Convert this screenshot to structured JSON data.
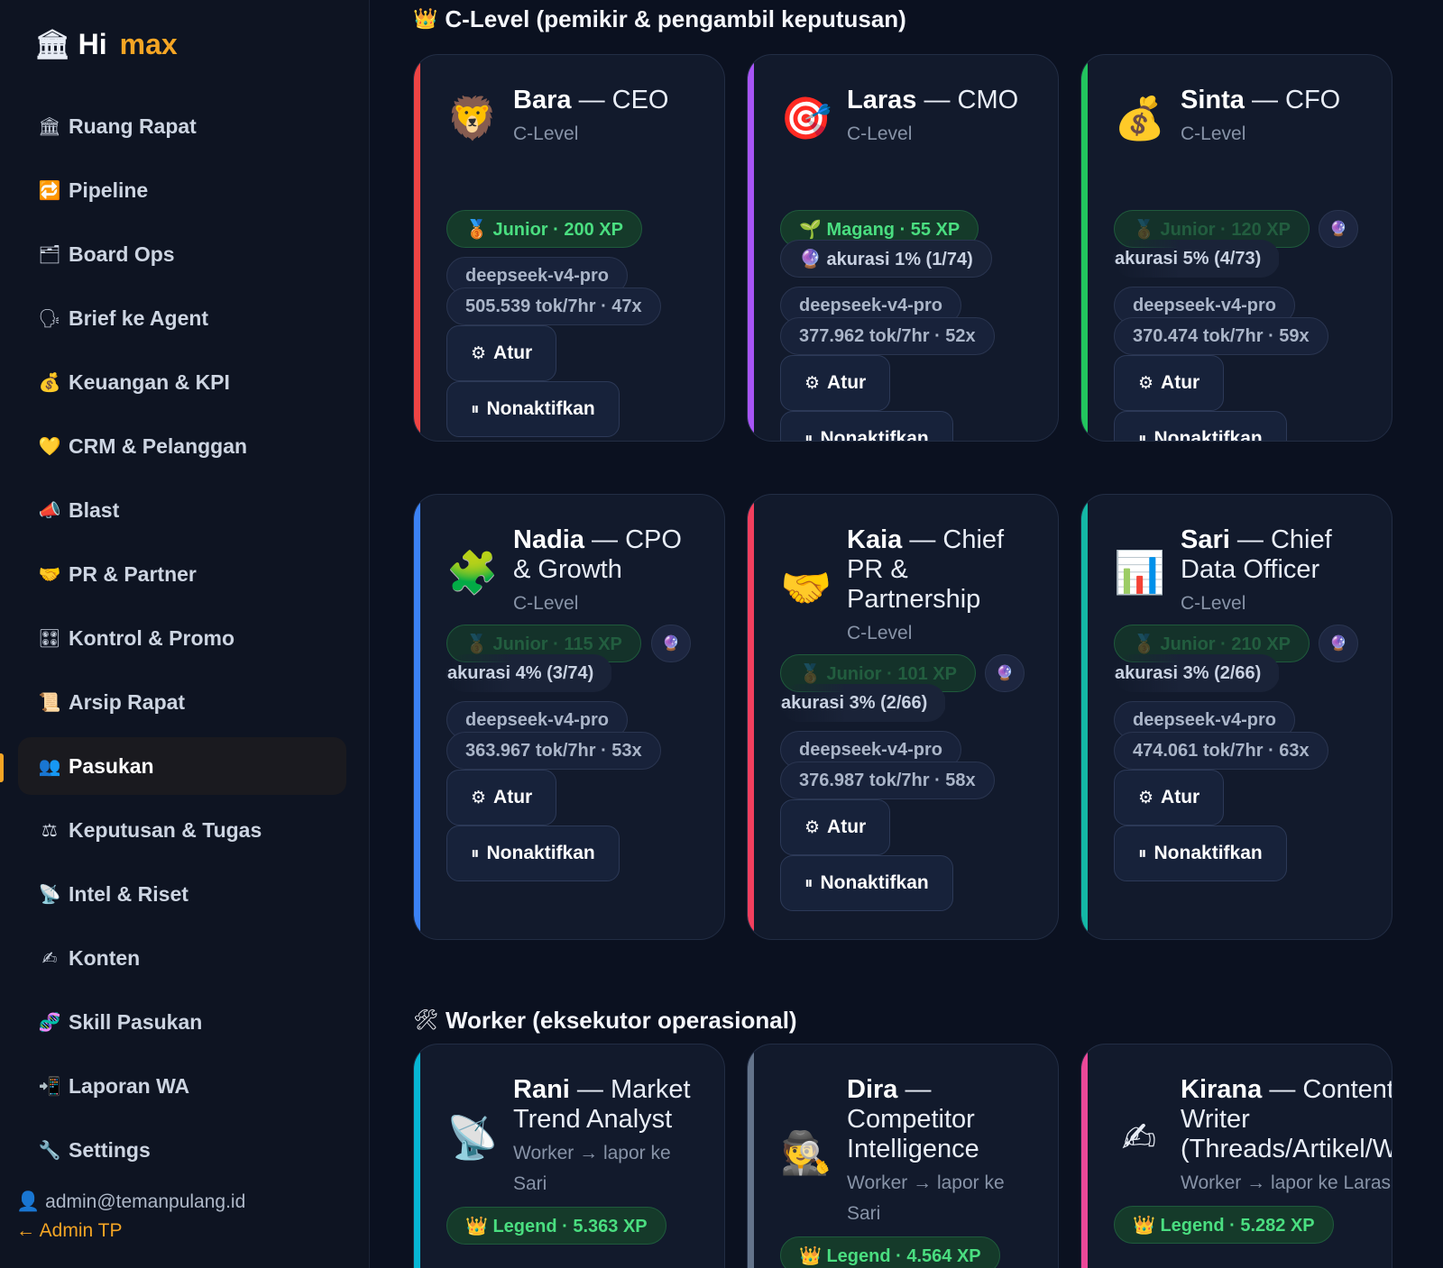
{
  "brand": {
    "icon": "🏛",
    "hi": "Hi",
    "max": "max"
  },
  "nav": [
    {
      "icon": "🏛",
      "label": "Ruang Rapat"
    },
    {
      "icon": "🔁",
      "label": "Pipeline"
    },
    {
      "icon": "🗂",
      "label": "Board Ops"
    },
    {
      "icon": "🗣",
      "label": "Brief ke Agent"
    },
    {
      "icon": "💰",
      "label": "Keuangan & KPI"
    },
    {
      "icon": "💛",
      "label": "CRM & Pelanggan"
    },
    {
      "icon": "📣",
      "label": "Blast"
    },
    {
      "icon": "🤝",
      "label": "PR & Partner"
    },
    {
      "icon": "🎛",
      "label": "Kontrol & Promo"
    },
    {
      "icon": "📜",
      "label": "Arsip Rapat"
    },
    {
      "icon": "👥",
      "label": "Pasukan"
    },
    {
      "icon": "⚖",
      "label": "Keputusan & Tugas"
    },
    {
      "icon": "📡",
      "label": "Intel & Riset"
    },
    {
      "icon": "✍",
      "label": "Konten"
    },
    {
      "icon": "🧬",
      "label": "Skill Pasukan"
    },
    {
      "icon": "📲",
      "label": "Laporan WA"
    },
    {
      "icon": "🔧",
      "label": "Settings"
    }
  ],
  "active_nav": "Pasukan",
  "user": {
    "icon": "👤",
    "email": "admin@temanpulang.id",
    "admin_link": "← Admin TP"
  },
  "sections": {
    "clevel": {
      "icon": "👑",
      "title": "C-Level (pemikir & pengambil keputusan)"
    },
    "worker": {
      "icon": "🛠",
      "title": "Worker (eksekutor operasional)"
    }
  },
  "buttons": {
    "atur_icon": "⚙",
    "atur": "Atur",
    "nonaktif_icon": "⏸",
    "nonaktif": "Nonaktifkan"
  },
  "agents": [
    {
      "avatar": "🦁",
      "name": "Bara",
      "role": "— CEO",
      "sub": "C-Level",
      "accent": "#ef4444",
      "level": "🥉 Junior · 200 XP",
      "accuracy": "",
      "model": "deepseek-v4-pro",
      "tokens": "505.539 tok/7hr · 47x"
    },
    {
      "avatar": "🎯",
      "name": "Laras",
      "role": "— CMO",
      "sub": "C-Level",
      "accent": "#a855f7",
      "level": "🌱 Magang · 55 XP",
      "accuracy": "🔮 akurasi 1% (1/74)",
      "model": "deepseek-v4-pro",
      "tokens": "377.962 tok/7hr · 52x"
    },
    {
      "avatar": "💰",
      "name": "Sinta",
      "role": "— CFO",
      "sub": "C-Level",
      "accent": "#22c55e",
      "level": "🥉 Junior · 120 XP",
      "accuracy": "akurasi 5% (4/73)",
      "model": "deepseek-v4-pro",
      "tokens": "370.474 tok/7hr · 59x",
      "orb": "🔮"
    },
    {
      "avatar": "🧩",
      "name": "Nadia",
      "role": "— CPO & Growth",
      "sub": "C-Level",
      "accent": "#3b82f6",
      "level": "🥉 Junior · 115 XP",
      "accuracy": "akurasi 4% (3/74)",
      "model": "deepseek-v4-pro",
      "tokens": "363.967 tok/7hr · 53x",
      "orb": "🔮"
    },
    {
      "avatar": "🤝",
      "name": "Kaia",
      "role": "— Chief PR & Partnership",
      "sub": "C-Level",
      "accent": "#f43f5e",
      "level": "🥉 Junior · 101 XP",
      "accuracy": "akurasi 3% (2/66)",
      "model": "deepseek-v4-pro",
      "tokens": "376.987 tok/7hr · 58x",
      "orb": "🔮"
    },
    {
      "avatar": "📊",
      "name": "Sari",
      "role": "— Chief Data Officer",
      "sub": "C-Level",
      "accent": "#14b8a6",
      "level": "🥉 Junior · 210 XP",
      "accuracy": "akurasi 3% (2/66)",
      "model": "deepseek-v4-pro",
      "tokens": "474.061 tok/7hr · 63x",
      "orb": "🔮"
    },
    {
      "avatar": "📡",
      "name": "Rani",
      "role": "— Market Trend Analyst",
      "sub": "Worker → lapor ke Sari",
      "accent": "#06b6d4",
      "level": "👑 Legend · 5.363 XP"
    },
    {
      "avatar": "🕵",
      "name": "Dira",
      "role": "— Competitor Intelligence",
      "sub": "Worker → lapor ke Sari",
      "accent": "#64748b",
      "level": "👑 Legend · 4.564 XP"
    },
    {
      "avatar": "✍",
      "name": "Kirana",
      "role": "— Content Writer (Threads/Artikel/WA)",
      "sub": "Worker → lapor ke Laras",
      "accent": "#ec4899",
      "level": "👑 Legend · 5.282 XP"
    }
  ]
}
